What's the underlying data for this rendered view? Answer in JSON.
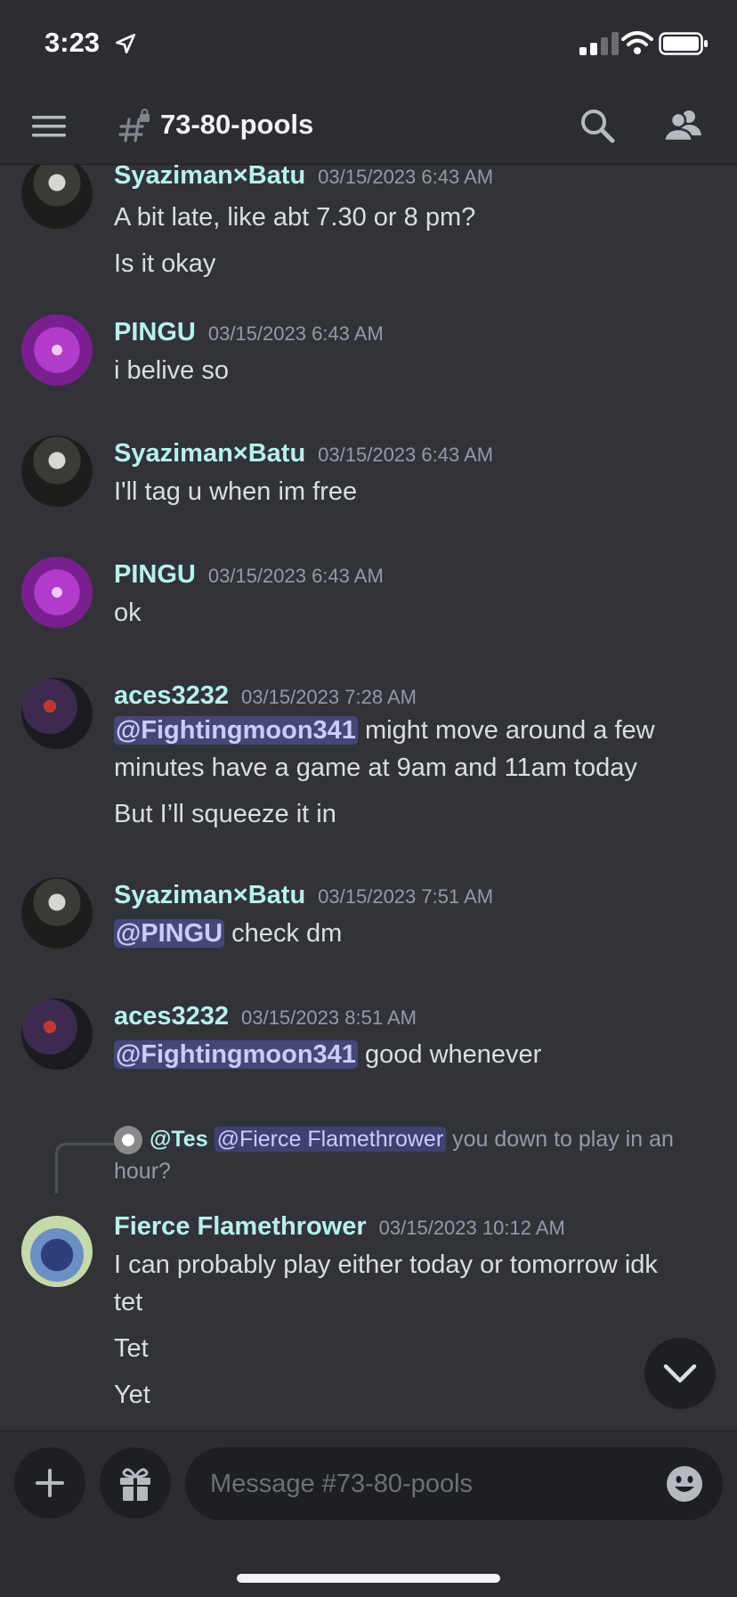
{
  "status_bar": {
    "time": "3:23"
  },
  "header": {
    "channel": "73-80-pools"
  },
  "messages": [
    {
      "user": "Syaziman×Batu",
      "timestamp": "03/15/2023 6:43 AM",
      "lines": [
        "A bit late, like abt 7.30 or 8 pm?",
        "Is it okay"
      ]
    },
    {
      "user": "PINGU",
      "timestamp": "03/15/2023 6:43 AM",
      "lines": [
        "i belive so"
      ]
    },
    {
      "user": "Syaziman×Batu",
      "timestamp": "03/15/2023 6:43 AM",
      "lines": [
        "I'll tag u when im free"
      ]
    },
    {
      "user": "PINGU",
      "timestamp": "03/15/2023 6:43 AM",
      "lines": [
        "ok"
      ]
    },
    {
      "user": "aces3232",
      "timestamp": "03/15/2023 7:28 AM",
      "mention": "@Fightingmoon341",
      "lines": [
        " might move around a few",
        "minutes have a game at 9am and 11am today",
        "But I’ll squeeze it in"
      ]
    },
    {
      "user": "Syaziman×Batu",
      "timestamp": "03/15/2023 7:51 AM",
      "mention": "@PINGU",
      "lines": [
        " check dm"
      ]
    },
    {
      "user": "aces3232",
      "timestamp": "03/15/2023 8:51 AM",
      "mention": "@Fightingmoon341",
      "lines": [
        " good whenever"
      ]
    },
    {
      "reply": {
        "user": "@Tes",
        "mention": "@Fierce Flamethrower",
        "text": " you down to play in an",
        "text2": "hour?"
      },
      "user": "Fierce Flamethrower",
      "timestamp": "03/15/2023 10:12 AM",
      "lines": [
        "I can probably play either today or tomorrow idk",
        "tet",
        "Tet",
        "Yet"
      ]
    }
  ],
  "composer": {
    "placeholder": "Message #73-80-pools"
  },
  "icons": {
    "menu": "hamburger-icon",
    "channel": "locked-hash-icon",
    "search": "search-icon",
    "members": "members-icon",
    "add": "plus-icon",
    "gift": "gift-icon",
    "emoji": "emoji-icon",
    "scroll": "chevron-down-icon"
  },
  "colors": {
    "background": "#313338",
    "header": "#2b2d31",
    "username": "#b6f2ec",
    "mention_bg": "#45477a",
    "mention_text": "#c9cdfb"
  }
}
